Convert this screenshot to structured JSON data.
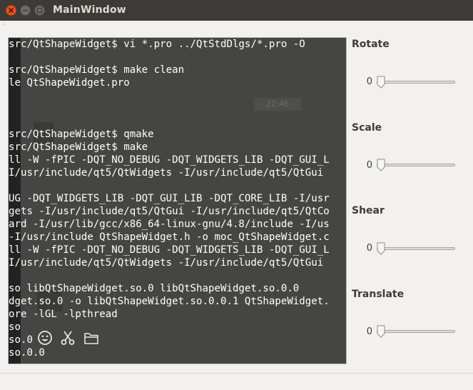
{
  "window": {
    "title": "MainWindow"
  },
  "terminal": {
    "lines": [
      "src/QtShapeWidget$ vi *.pro ../QtStdDlgs/*.pro -O",
      "",
      "src/QtShapeWidget$ make clean",
      "le QtShapeWidget.pro",
      "",
      "",
      "",
      "src/QtShapeWidget$ qmake",
      "src/QtShapeWidget$ make",
      "ll -W -fPIC -DQT_NO_DEBUG -DQT_WIDGETS_LIB -DQT_GUI_L",
      "I/usr/include/qt5/QtWidgets -I/usr/include/qt5/QtGui",
      "",
      "UG -DQT_WIDGETS_LIB -DQT_GUI_LIB -DQT_CORE_LIB -I/usr",
      "gets -I/usr/include/qt5/QtGui -I/usr/include/qt5/QtCo",
      "ard -I/usr/lib/gcc/x86_64-linux-gnu/4.8/include -I/us",
      "-I/usr/include QtShapeWidget.h -o moc_QtShapeWidget.c",
      "ll -W -fPIC -DQT_NO_DEBUG -DQT_WIDGETS_LIB -DQT_GUI_L",
      "I/usr/include/qt5/QtWidgets -I/usr/include/qt5/QtGui",
      "",
      "so libQtShapeWidget.so.0 libQtShapeWidget.so.0.0",
      "dget.so.0 -o libQtShapeWidget.so.0.0.1 QtShapeWidget.",
      "ore -lGL -lpthread",
      "so",
      "so.0",
      "so.0.0"
    ],
    "clock": "22:46"
  },
  "controls": [
    {
      "label": "Rotate",
      "value": "0",
      "level": 0
    },
    {
      "label": "Scale",
      "value": "0",
      "level": 0
    },
    {
      "label": "Shear",
      "value": "0",
      "level": 0
    },
    {
      "label": "Translate",
      "value": "0",
      "level": 0
    }
  ],
  "icons": {
    "close": "close-icon",
    "minimize": "minimize-icon",
    "maximize": "maximize-icon",
    "emoji": "smiley-icon",
    "scissors": "scissors-icon",
    "folder": "folder-icon"
  },
  "colors": {
    "titlebar": "#3c3b37",
    "close_button": "#e9541f",
    "terminal_bg": "#454544",
    "window_bg": "#f2f1f0"
  }
}
